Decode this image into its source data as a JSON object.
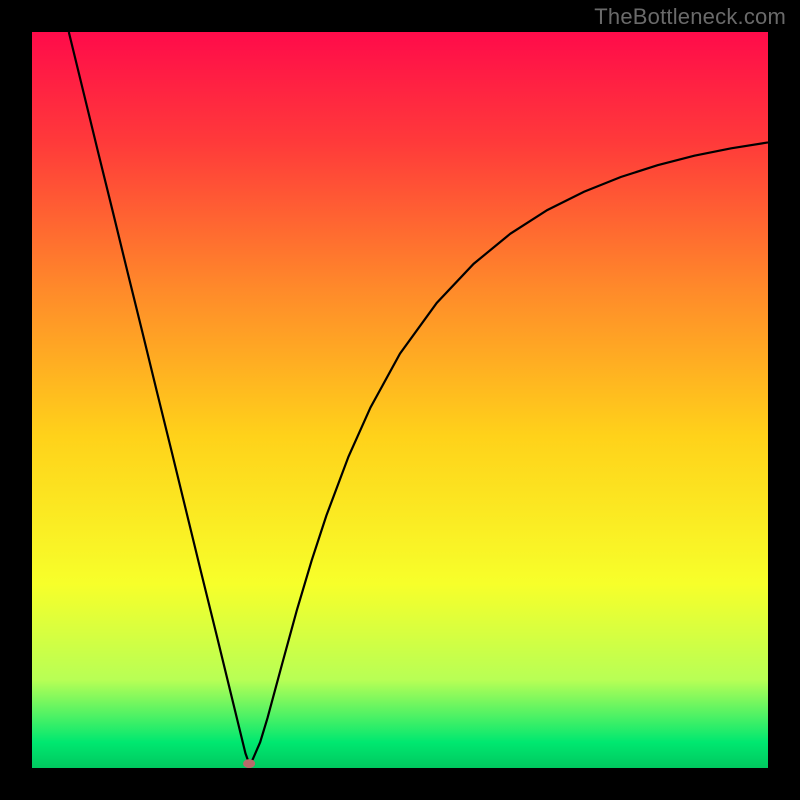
{
  "watermark": "TheBottleneck.com",
  "chart_data": {
    "type": "line",
    "title": "",
    "xlabel": "",
    "ylabel": "",
    "xlim": [
      0,
      100
    ],
    "ylim": [
      0,
      100
    ],
    "background_gradient": {
      "stops": [
        {
          "offset": 0.0,
          "color": "#ff0b4a"
        },
        {
          "offset": 0.15,
          "color": "#ff3a3a"
        },
        {
          "offset": 0.35,
          "color": "#ff8a2a"
        },
        {
          "offset": 0.55,
          "color": "#ffd21a"
        },
        {
          "offset": 0.75,
          "color": "#f7ff2a"
        },
        {
          "offset": 0.88,
          "color": "#b8ff55"
        },
        {
          "offset": 0.965,
          "color": "#00e870"
        },
        {
          "offset": 1.0,
          "color": "#00c85f"
        }
      ]
    },
    "marker_point": {
      "x": 29.5,
      "y": 0.6,
      "color": "#b86a6a"
    },
    "series": [
      {
        "name": "curve",
        "color": "#000000",
        "points": [
          {
            "x": 5.0,
            "y": 100.0
          },
          {
            "x": 7.0,
            "y": 91.8
          },
          {
            "x": 9.0,
            "y": 83.6
          },
          {
            "x": 11.0,
            "y": 75.5
          },
          {
            "x": 13.0,
            "y": 67.3
          },
          {
            "x": 15.0,
            "y": 59.2
          },
          {
            "x": 17.0,
            "y": 51.0
          },
          {
            "x": 19.0,
            "y": 42.9
          },
          {
            "x": 21.0,
            "y": 34.7
          },
          {
            "x": 23.0,
            "y": 26.5
          },
          {
            "x": 25.0,
            "y": 18.4
          },
          {
            "x": 27.0,
            "y": 10.2
          },
          {
            "x": 28.0,
            "y": 6.1
          },
          {
            "x": 29.0,
            "y": 2.0
          },
          {
            "x": 29.5,
            "y": 0.6
          },
          {
            "x": 30.0,
            "y": 1.2
          },
          {
            "x": 31.0,
            "y": 3.5
          },
          {
            "x": 32.0,
            "y": 6.8
          },
          {
            "x": 33.0,
            "y": 10.5
          },
          {
            "x": 34.0,
            "y": 14.2
          },
          {
            "x": 36.0,
            "y": 21.5
          },
          {
            "x": 38.0,
            "y": 28.2
          },
          {
            "x": 40.0,
            "y": 34.3
          },
          {
            "x": 43.0,
            "y": 42.3
          },
          {
            "x": 46.0,
            "y": 49.0
          },
          {
            "x": 50.0,
            "y": 56.3
          },
          {
            "x": 55.0,
            "y": 63.2
          },
          {
            "x": 60.0,
            "y": 68.5
          },
          {
            "x": 65.0,
            "y": 72.6
          },
          {
            "x": 70.0,
            "y": 75.8
          },
          {
            "x": 75.0,
            "y": 78.3
          },
          {
            "x": 80.0,
            "y": 80.3
          },
          {
            "x": 85.0,
            "y": 81.9
          },
          {
            "x": 90.0,
            "y": 83.2
          },
          {
            "x": 95.0,
            "y": 84.2
          },
          {
            "x": 100.0,
            "y": 85.0
          }
        ]
      }
    ]
  }
}
